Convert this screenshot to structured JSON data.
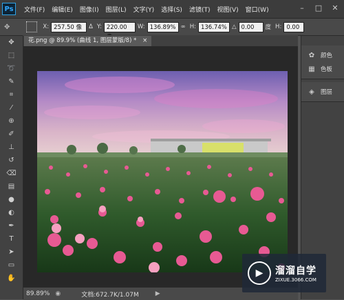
{
  "app": {
    "logo_text": "Ps"
  },
  "menu": [
    "文件(F)",
    "编辑(E)",
    "图像(I)",
    "图层(L)",
    "文字(Y)",
    "选择(S)",
    "滤镜(T)",
    "视图(V)",
    "窗口(W)"
  ],
  "window_controls": {
    "minimize": "–",
    "restore": "□",
    "close": "✕"
  },
  "options": {
    "x_label": "X:",
    "x_value": "257.50 像",
    "delta_label": "Δ",
    "y_label": "Y:",
    "y_value": "220.00 像",
    "w_label": "W:",
    "w_value": "136.89%",
    "link_symbol": "∞",
    "h_label": "H:",
    "h_value": "136.74%",
    "angle_symbol": "△",
    "angle_value": "0.00",
    "angle_unit": "度",
    "hskew_label": "H:",
    "hskew_value": "0.00"
  },
  "document_tab": {
    "title": "花.png @ 89.9% (曲线 1, 图层蒙版/8) *",
    "close": "×"
  },
  "status": {
    "zoom": "89.89%",
    "doc_info": "文档:672.7K/1.07M"
  },
  "panels": [
    {
      "icon": "palette-icon",
      "label": "颜色"
    },
    {
      "icon": "swatches-icon",
      "label": "色板"
    },
    {
      "icon": "layers-icon",
      "label": "图层"
    }
  ],
  "watermark": {
    "brand": "溜溜自学",
    "url": "ZIXUE.3066.COM"
  }
}
